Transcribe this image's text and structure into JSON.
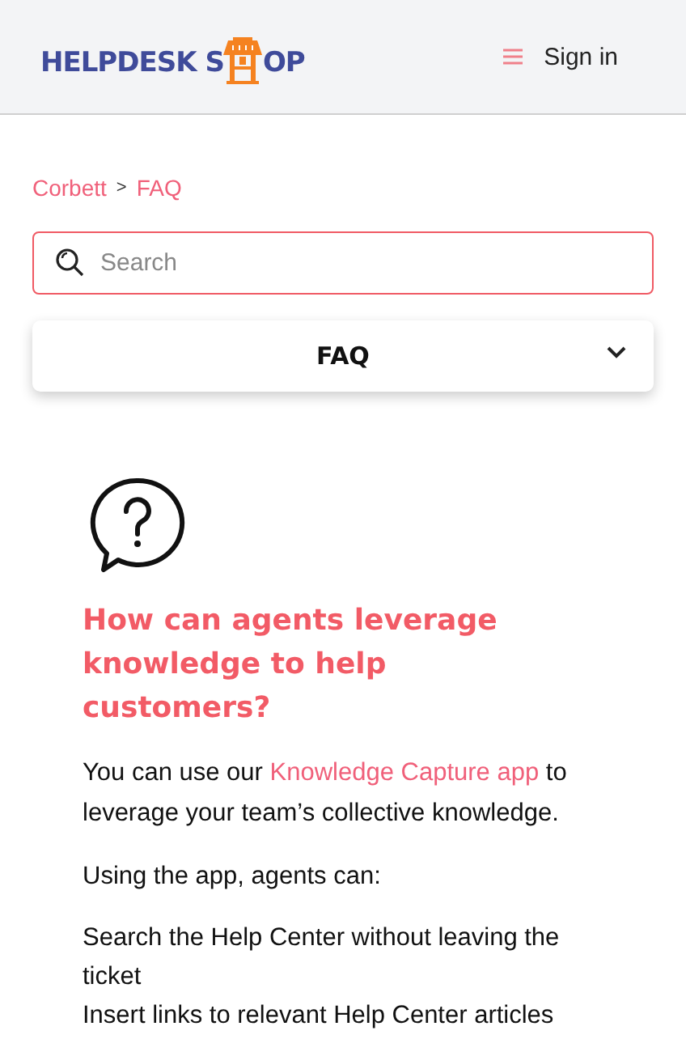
{
  "header": {
    "logo": {
      "text_before": "HELPDESK S",
      "text_after": "OP"
    },
    "sign_in": "Sign in"
  },
  "breadcrumb": [
    "Corbett",
    "FAQ"
  ],
  "breadcrumb_separator": ">",
  "search": {
    "placeholder": "Search"
  },
  "category_dropdown": {
    "label": "FAQ",
    "expanded": false
  },
  "article": {
    "title": "How can agents leverage knowledge to help customers?",
    "intro": {
      "before": "You can use our ",
      "link": "Knowledge Capture app",
      "after": " to leverage your team’s collective knowledge."
    },
    "paragraphs": [
      "Using the app, agents can:"
    ],
    "lines": [
      "Search the Help Center without leaving the ticket",
      "Insert links to relevant Help Center articles"
    ]
  }
}
